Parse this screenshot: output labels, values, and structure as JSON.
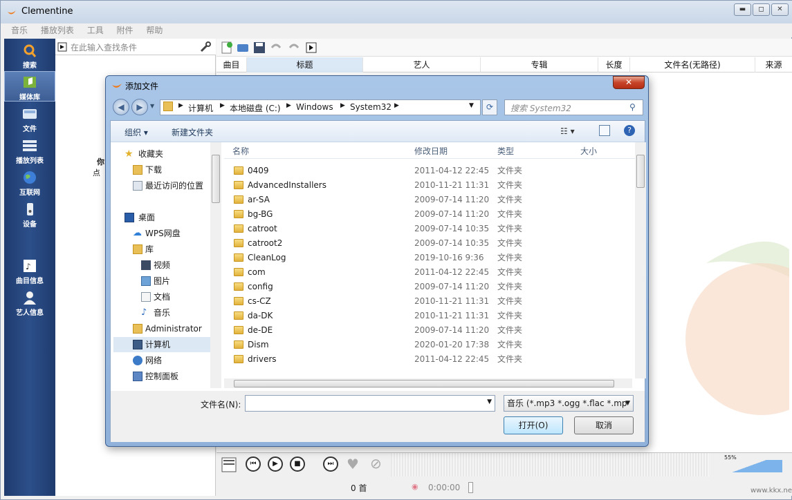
{
  "app": {
    "title": "Clementine"
  },
  "window_controls": {
    "minimize": "▬",
    "maximize": "◻",
    "close": "✕"
  },
  "menu": [
    "音乐",
    "播放列表",
    "工具",
    "附件",
    "帮助"
  ],
  "sidebar": [
    {
      "label": "搜索",
      "icon": "search-icon"
    },
    {
      "label": "媒体库",
      "icon": "library-icon"
    },
    {
      "label": "文件",
      "icon": "files-icon"
    },
    {
      "label": "播放列表",
      "icon": "playlists-icon"
    },
    {
      "label": "互联网",
      "icon": "internet-icon"
    },
    {
      "label": "设备",
      "icon": "devices-icon"
    },
    {
      "label": "曲目信息",
      "icon": "song-info-icon"
    },
    {
      "label": "艺人信息",
      "icon": "artist-info-icon"
    }
  ],
  "library": {
    "search_placeholder": "在此输入查找条件",
    "partial_text_1": "你",
    "partial_text_2": "点"
  },
  "playlist_columns": [
    "曲目",
    "标题",
    "艺人",
    "专辑",
    "长度",
    "文件名(无路径)",
    "来源"
  ],
  "player": {
    "track_count": "0 首",
    "time": "0:00:00",
    "volume": "55%",
    "watermark_text": "www.kkx.net"
  },
  "dialog": {
    "title": "添加文件",
    "close": "✕",
    "breadcrumb": [
      "计算机",
      "本地磁盘 (C:)",
      "Windows",
      "System32"
    ],
    "search_placeholder": "搜索 System32",
    "organize": "组织 ▾",
    "new_folder": "新建文件夹",
    "nav": [
      {
        "label": "收藏夹",
        "icon": "star-icon"
      },
      {
        "label": "下载",
        "icon": "download-folder-icon"
      },
      {
        "label": "最近访问的位置",
        "icon": "recent-places-icon"
      },
      {
        "label": "桌面",
        "icon": "desktop-icon"
      },
      {
        "label": "WPS网盘",
        "icon": "cloud-icon"
      },
      {
        "label": "库",
        "icon": "library-folder-icon"
      },
      {
        "label": "视频",
        "icon": "video-icon"
      },
      {
        "label": "图片",
        "icon": "pictures-icon"
      },
      {
        "label": "文档",
        "icon": "documents-icon"
      },
      {
        "label": "音乐",
        "icon": "music-icon"
      },
      {
        "label": "Administrator",
        "icon": "user-folder-icon"
      },
      {
        "label": "计算机",
        "icon": "computer-icon"
      },
      {
        "label": "网络",
        "icon": "network-icon"
      },
      {
        "label": "控制面板",
        "icon": "control-panel-icon"
      }
    ],
    "columns": [
      "名称",
      "修改日期",
      "类型",
      "大小"
    ],
    "files": [
      {
        "name": "0409",
        "date": "2011-04-12 22:45",
        "type": "文件夹"
      },
      {
        "name": "AdvancedInstallers",
        "date": "2010-11-21 11:31",
        "type": "文件夹"
      },
      {
        "name": "ar-SA",
        "date": "2009-07-14 11:20",
        "type": "文件夹"
      },
      {
        "name": "bg-BG",
        "date": "2009-07-14 11:20",
        "type": "文件夹"
      },
      {
        "name": "catroot",
        "date": "2009-07-14 10:35",
        "type": "文件夹"
      },
      {
        "name": "catroot2",
        "date": "2009-07-14 10:35",
        "type": "文件夹"
      },
      {
        "name": "CleanLog",
        "date": "2019-10-16 9:36",
        "type": "文件夹"
      },
      {
        "name": "com",
        "date": "2011-04-12 22:45",
        "type": "文件夹"
      },
      {
        "name": "config",
        "date": "2009-07-14 11:20",
        "type": "文件夹"
      },
      {
        "name": "cs-CZ",
        "date": "2010-11-21 11:31",
        "type": "文件夹"
      },
      {
        "name": "da-DK",
        "date": "2010-11-21 11:31",
        "type": "文件夹"
      },
      {
        "name": "de-DE",
        "date": "2009-07-14 11:20",
        "type": "文件夹"
      },
      {
        "name": "Dism",
        "date": "2020-01-20 17:38",
        "type": "文件夹"
      },
      {
        "name": "drivers",
        "date": "2011-04-12 22:45",
        "type": "文件夹"
      }
    ],
    "filename_label": "文件名(N):",
    "filename_value": "",
    "filter": "音乐 (*.mp3 *.ogg *.flac *.mp",
    "ok": "打开(O)",
    "cancel": "取消"
  }
}
